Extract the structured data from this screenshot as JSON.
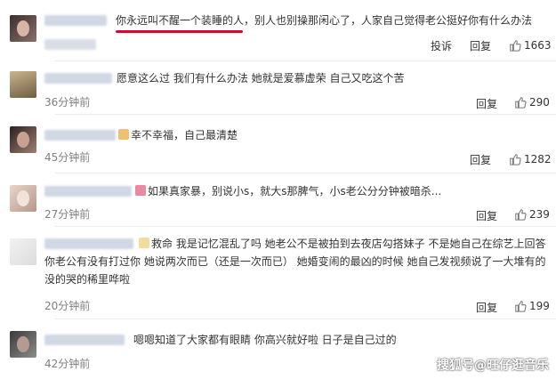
{
  "comments": [
    {
      "text": "你永远叫不醒一个装睡的人，别人也别操那闲心了，人家自己觉得老公挺好你有什么办法",
      "highlight": "你永远叫不醒一个装睡的人",
      "time": "",
      "report_label": "投诉",
      "reply_label": "回复",
      "likes": "1663"
    },
    {
      "text": "愿意这么过 我们有什么办法 她就是爱慕虚荣 自己又吃这个苦",
      "time": "36分钟前",
      "reply_label": "回复",
      "likes": "290"
    },
    {
      "text": "幸不幸福，自己最清楚",
      "time": "45分钟前",
      "reply_label": "回复",
      "likes": "1282"
    },
    {
      "text": "如果真家暴，别说小s，就大s那脾气，小s老公分分钟被暗杀...",
      "time": "27分钟前",
      "reply_label": "回复",
      "likes": "239"
    },
    {
      "text": "救命 我是记忆混乱了吗 她老公不是被拍到去夜店勾搭妹子 不是她自己在综艺上回答你老公有没有打过你 她说两次而已（还是一次而已） 她婚变闹的最凶的时候 她自己发视频说了一大堆有的没的哭的稀里哗啦",
      "time": "20分钟前",
      "reply_label": "回复",
      "likes": "199"
    },
    {
      "text": "嗯嗯知道了大家都有眼睛 你高兴就好啦 日子是自己过的",
      "time": "42分钟前",
      "reply_label": "回复",
      "likes": ""
    }
  ],
  "watermark": "搜狐号@旺仔逛音乐",
  "colors": {
    "accent": "#c8102e",
    "time": "#808080",
    "text": "#333333"
  },
  "icons": {
    "like": "thumbs-up-icon"
  }
}
